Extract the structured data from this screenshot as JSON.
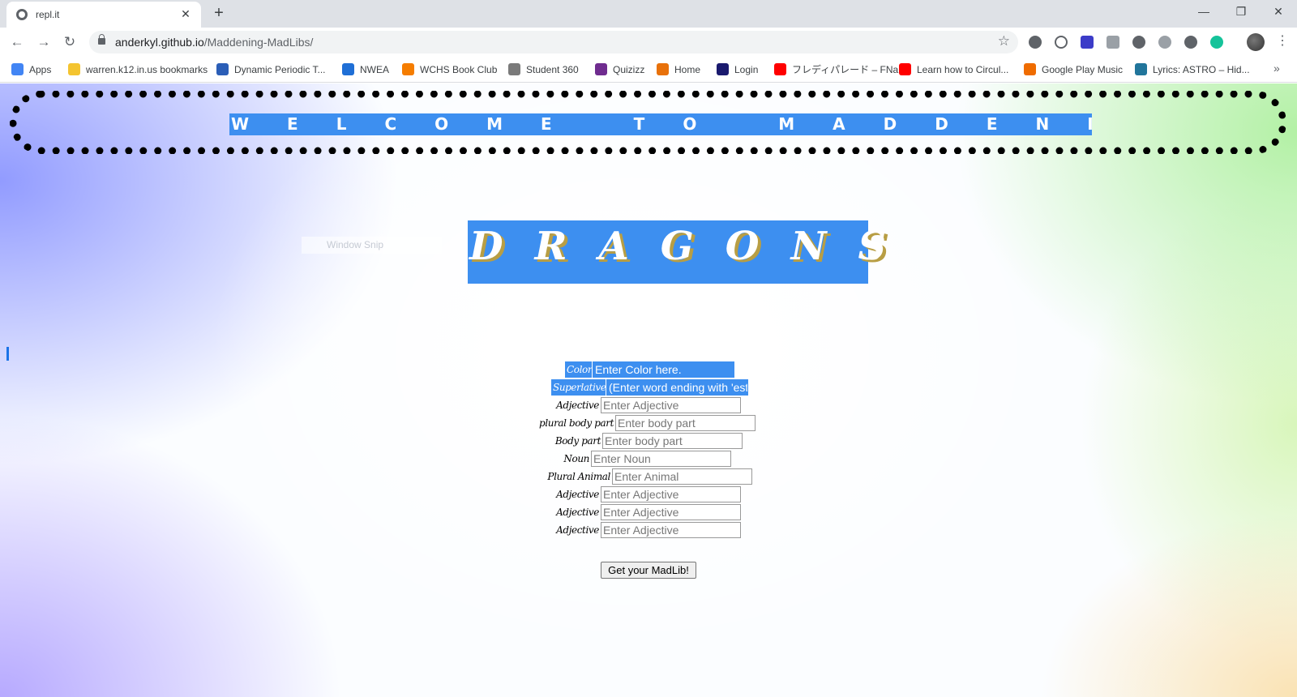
{
  "browser": {
    "tab_title": "repl.it",
    "new_tab": "+",
    "url_host": "anderkyl.github.io",
    "url_path": "/Maddening-MadLibs/",
    "window_controls": {
      "minimize": "—",
      "restore": "❐",
      "close": "✕"
    },
    "extensions": [
      "extension-icon",
      "power-icon",
      "c-extension-icon",
      "puzzle-icon",
      "lp-icon",
      "at-icon",
      "lp-icon",
      "grammarly-icon"
    ]
  },
  "bookmarks": [
    {
      "label": "Apps",
      "icon": "apps-grid-icon",
      "color": "#4285f4"
    },
    {
      "label": "warren.k12.in.us bookmarks",
      "icon": "folder-icon",
      "color": "#f4c430"
    },
    {
      "label": "Dynamic Periodic T...",
      "icon": "pt-icon",
      "color": "#2b5eb7"
    },
    {
      "label": "NWEA",
      "icon": "nwea-icon",
      "color": "#1f6fd6"
    },
    {
      "label": "WCHS Book Club",
      "icon": "blogger-icon",
      "color": "#f57d00"
    },
    {
      "label": "Student 360",
      "icon": "student360-icon",
      "color": "#7a7a7a"
    },
    {
      "label": "Quizizz",
      "icon": "quizizz-icon",
      "color": "#6f2c8f"
    },
    {
      "label": "Home",
      "icon": "home-icon",
      "color": "#e8710a"
    },
    {
      "label": "Login",
      "icon": "login-icon",
      "color": "#1a1a6e"
    },
    {
      "label": "フレディパレード – FNa...",
      "icon": "youtube-icon",
      "color": "#ff0000"
    },
    {
      "label": "Learn how to Circul...",
      "icon": "youtube-icon",
      "color": "#ff0000"
    },
    {
      "label": "Google Play Music",
      "icon": "play-music-icon",
      "color": "#ef6c00"
    },
    {
      "label": "Lyrics: ASTRO – Hid...",
      "icon": "wordpress-icon",
      "color": "#21759b"
    }
  ],
  "page": {
    "welcome": "WELCOME TO MADDENING MADLIBS!",
    "title": "DRAGONS",
    "snip_ghost": "Window Snip",
    "accent": "#3d8ff0"
  },
  "form": {
    "fields": [
      {
        "label": "Color",
        "placeholder": "Enter Color here."
      },
      {
        "label": "Superlative",
        "placeholder": "(Enter word ending with 'est')"
      },
      {
        "label": "Adjective",
        "placeholder": "Enter Adjective"
      },
      {
        "label": "plural body part",
        "placeholder": "Enter body part"
      },
      {
        "label": "Body part",
        "placeholder": "Enter body part"
      },
      {
        "label": "Noun",
        "placeholder": "Enter Noun"
      },
      {
        "label": "Plural Animal",
        "placeholder": "Enter Animal"
      },
      {
        "label": "Adjective",
        "placeholder": "Enter Adjective"
      },
      {
        "label": "Adjective",
        "placeholder": "Enter Adjective"
      },
      {
        "label": "Adjective",
        "placeholder": "Enter Adjective"
      }
    ],
    "submit_label": "Get your MadLib!"
  }
}
